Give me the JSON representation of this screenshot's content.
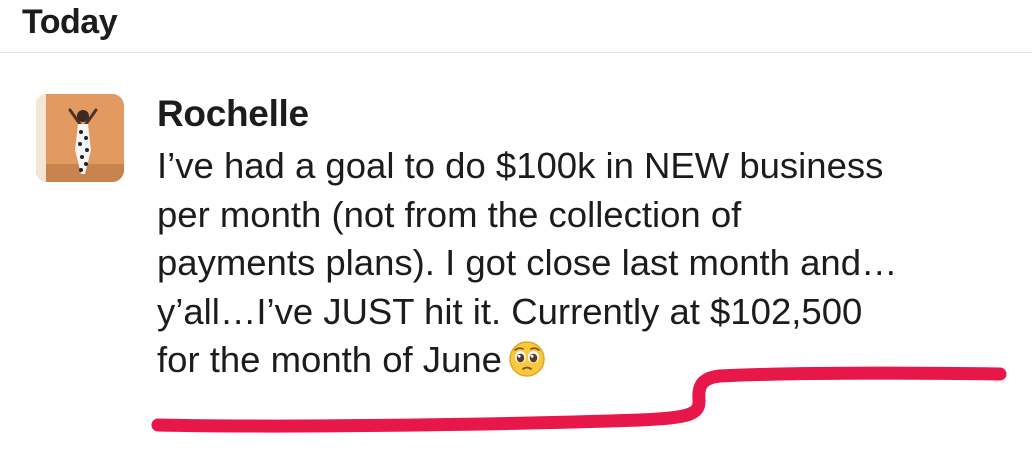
{
  "header": {
    "day_label": "Today"
  },
  "message": {
    "sender": "Rochelle",
    "avatar_icon": "user-photo-avatar",
    "lines": [
      "I’ve had a goal to do $100k in NEW business",
      "per month (not from the collection of",
      "payments plans). I got close last month and…",
      "y’all…I’ve JUST hit it. Currently at $102,500",
      "for the month of June"
    ],
    "emoji_icon": "pleading-face-emoji-icon"
  },
  "annotation": {
    "underline_color": "#e8174a"
  },
  "colors": {
    "text": "#1d1c1d",
    "background": "#ffffff",
    "divider": "#e3e3e3"
  }
}
